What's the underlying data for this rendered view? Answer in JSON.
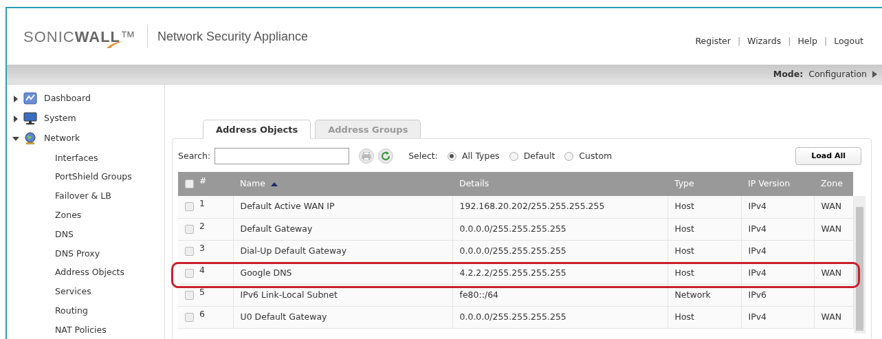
{
  "header": {
    "logo": "SONIC**WALL**™",
    "product": "Network Security Appliance",
    "links": [
      "Register",
      "Wizards",
      "Help",
      "Logout"
    ],
    "separators": [
      "|",
      "|",
      "|"
    ]
  },
  "mode_bar": {
    "label": "Mode:",
    "value": "Configuration"
  },
  "sidebar": {
    "items": [
      {
        "label": "Dashboard",
        "expanded": false
      },
      {
        "label": "System",
        "expanded": false
      },
      {
        "label": "Network",
        "expanded": true,
        "children": [
          {
            "label": "Interfaces"
          },
          {
            "label": "PortShield Groups"
          },
          {
            "label": "Failover & LB"
          },
          {
            "label": "Zones"
          },
          {
            "label": "DNS"
          },
          {
            "label": "DNS Proxy"
          },
          {
            "label": "Address Objects"
          },
          {
            "label": "Services"
          },
          {
            "label": "Routing"
          },
          {
            "label": "NAT Policies"
          }
        ]
      }
    ]
  },
  "tabs": [
    {
      "label": "Address Objects",
      "selected": true
    },
    {
      "label": "Address Groups",
      "selected": false
    }
  ],
  "toolbar": {
    "search_label": "Search:",
    "select_label": "Select:",
    "filters": [
      {
        "label": "All Types",
        "selected": true
      },
      {
        "label": "Default",
        "selected": false
      },
      {
        "label": "Custom",
        "selected": false
      }
    ],
    "load_all": "Load All"
  },
  "table": {
    "columns": [
      {
        "label": "#",
        "sorted": false
      },
      {
        "label": "Name",
        "sorted": true
      },
      {
        "label": "Details",
        "sorted": false
      },
      {
        "label": "Type",
        "sorted": false
      },
      {
        "label": "IP Version",
        "sorted": false
      },
      {
        "label": "Zone",
        "sorted": false
      }
    ],
    "header_checked": false,
    "rows": [
      {
        "number": "1",
        "name": "Default Active WAN IP",
        "details": "192.168.20.202/255.255.255.255",
        "type": "Host",
        "ip_version": "IPv4",
        "zone": "WAN",
        "checked": false,
        "highlighted": false
      },
      {
        "number": "2",
        "name": "Default Gateway",
        "details": "0.0.0.0/255.255.255.255",
        "type": "Host",
        "ip_version": "IPv4",
        "zone": "WAN",
        "checked": false,
        "highlighted": false
      },
      {
        "number": "3",
        "name": "Dial-Up Default Gateway",
        "details": "0.0.0.0/255.255.255.255",
        "type": "Host",
        "ip_version": "IPv4",
        "checked": false,
        "highlighted": false
      },
      {
        "number": "4",
        "name": "Google DNS",
        "details": "4.2.2.2/255.255.255.255",
        "type": "Host",
        "ip_version": "IPv4",
        "zone": "WAN",
        "checked": false,
        "highlighted": true
      },
      {
        "number": "5",
        "name": "IPv6 Link-Local Subnet",
        "details": "fe80::/64",
        "type": "Network",
        "ip_version": "IPv6",
        "checked": false,
        "highlighted": false
      },
      {
        "number": "6",
        "name": "U0 Default Gateway",
        "details": "0.0.0.0/255.255.255.255",
        "type": "Host",
        "ip_version": "IPv4",
        "zone": "WAN",
        "checked": false,
        "highlighted": false
      }
    ]
  }
}
